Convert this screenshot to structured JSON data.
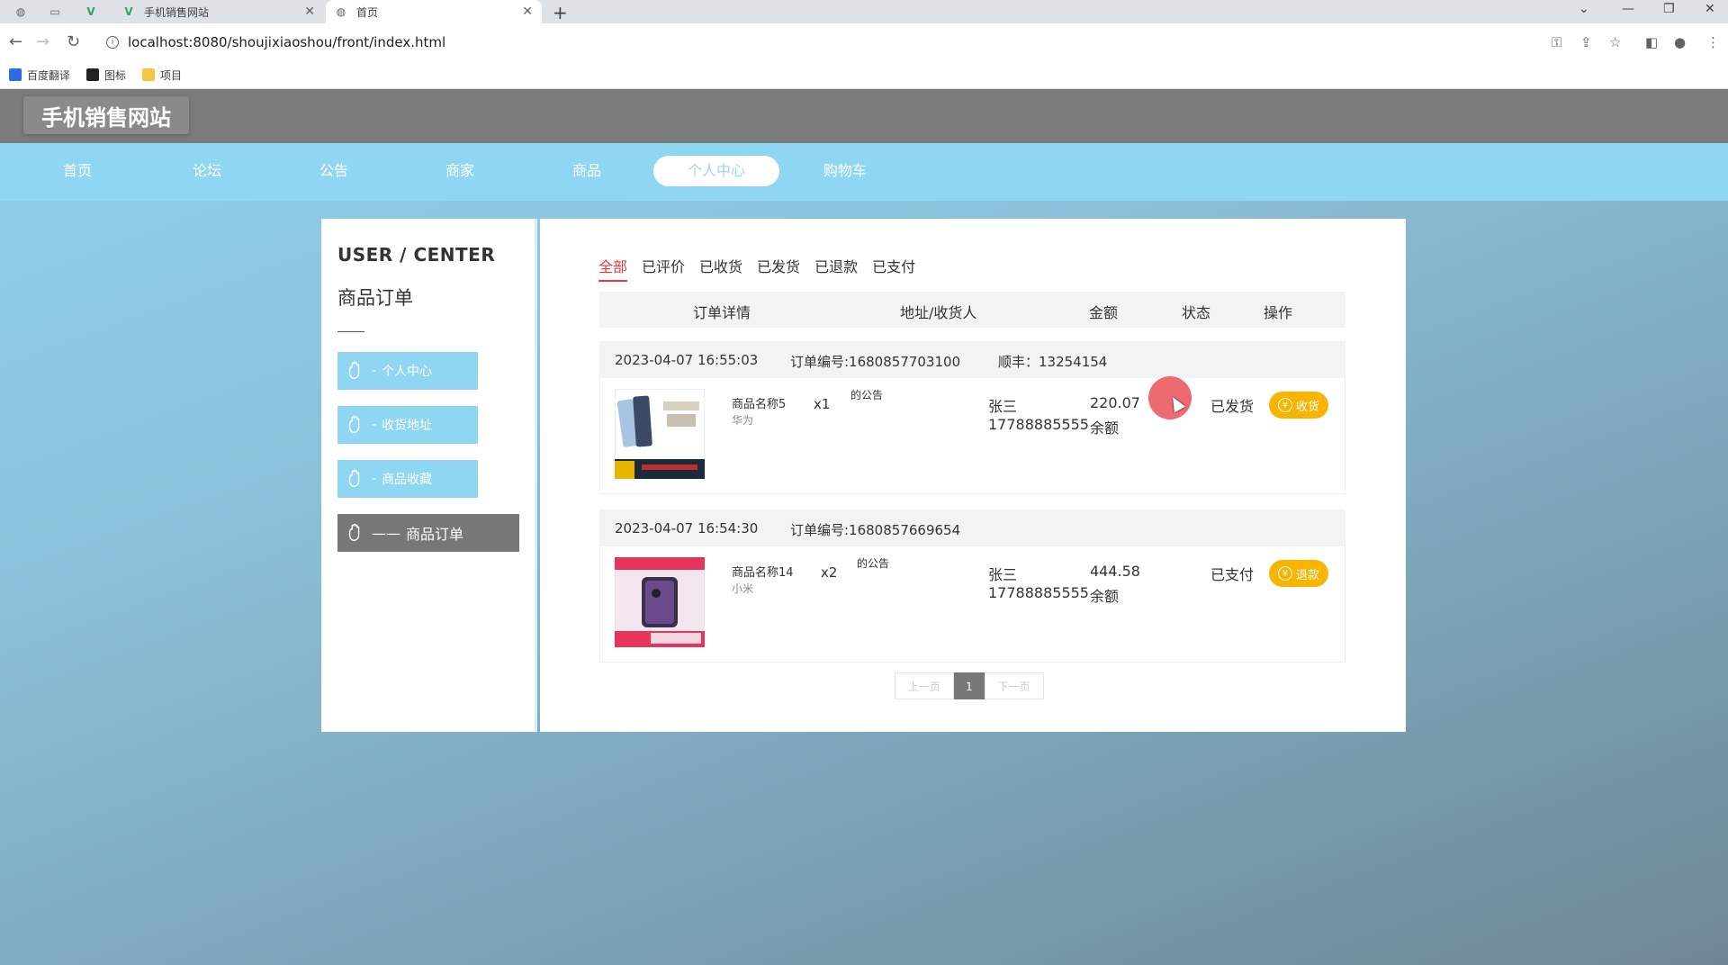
{
  "browser": {
    "tabs": [
      {
        "title": "手机销售网站",
        "favicon": "vue-icon",
        "active": false
      },
      {
        "title": "首页",
        "favicon": "globe-icon",
        "active": true
      }
    ],
    "url": "localhost:8080/shoujixiaoshou/front/index.html",
    "bookmarks": [
      {
        "label": "百度翻译",
        "icon": "translate-icon",
        "color": "#2b6de0"
      },
      {
        "label": "图标",
        "icon": "image-icon",
        "color": "#222222"
      },
      {
        "label": "项目",
        "icon": "folder-icon",
        "color": "#f2c744"
      }
    ]
  },
  "site": {
    "title": "手机销售网站",
    "nav": [
      {
        "label": "首页",
        "active": false
      },
      {
        "label": "论坛",
        "active": false
      },
      {
        "label": "公告",
        "active": false
      },
      {
        "label": "商家",
        "active": false
      },
      {
        "label": "商品",
        "active": false
      },
      {
        "label": "个人中心",
        "active": true
      },
      {
        "label": "购物车",
        "active": false
      }
    ]
  },
  "user_center": {
    "heading": "USER / CENTER",
    "subheading": "商品订单",
    "menu": [
      {
        "label": "个人中心",
        "active": false
      },
      {
        "label": "收货地址",
        "active": false
      },
      {
        "label": "商品收藏",
        "active": false
      },
      {
        "label": "商品订单",
        "active": true
      }
    ]
  },
  "orders": {
    "filters": [
      "全部",
      "已评价",
      "已收货",
      "已发货",
      "已退款",
      "已支付"
    ],
    "active_filter": "全部",
    "columns": [
      "订单详情",
      "地址/收货人",
      "金额",
      "状态",
      "操作"
    ],
    "items": [
      {
        "time": "2023-04-07 16:55:03",
        "order_no": "订单编号:1680857703100",
        "logistics": "顺丰：13254154",
        "product_name": "商品名称5",
        "brand": "华为",
        "qty": "x1",
        "notice": "的公告",
        "receiver": "张三",
        "phone": "17788885555",
        "amount": "220.07",
        "pay_type": "余额",
        "status": "已发货",
        "action": "收货"
      },
      {
        "time": "2023-04-07 16:54:30",
        "order_no": "订单编号:1680857669654",
        "logistics": "",
        "product_name": "商品名称14",
        "brand": "小米",
        "qty": "x2",
        "notice": "的公告",
        "receiver": "张三",
        "phone": "17788885555",
        "amount": "444.58",
        "pay_type": "余额",
        "status": "已支付",
        "action": "退款"
      }
    ],
    "pager": {
      "prev": "上一页",
      "current": "1",
      "next": "下一页"
    }
  },
  "colors": {
    "nav_bg": "#8fd6f2",
    "header_bg": "#7b7b7b",
    "accent_red": "#e4393c",
    "action_btn": "#f7b500"
  }
}
